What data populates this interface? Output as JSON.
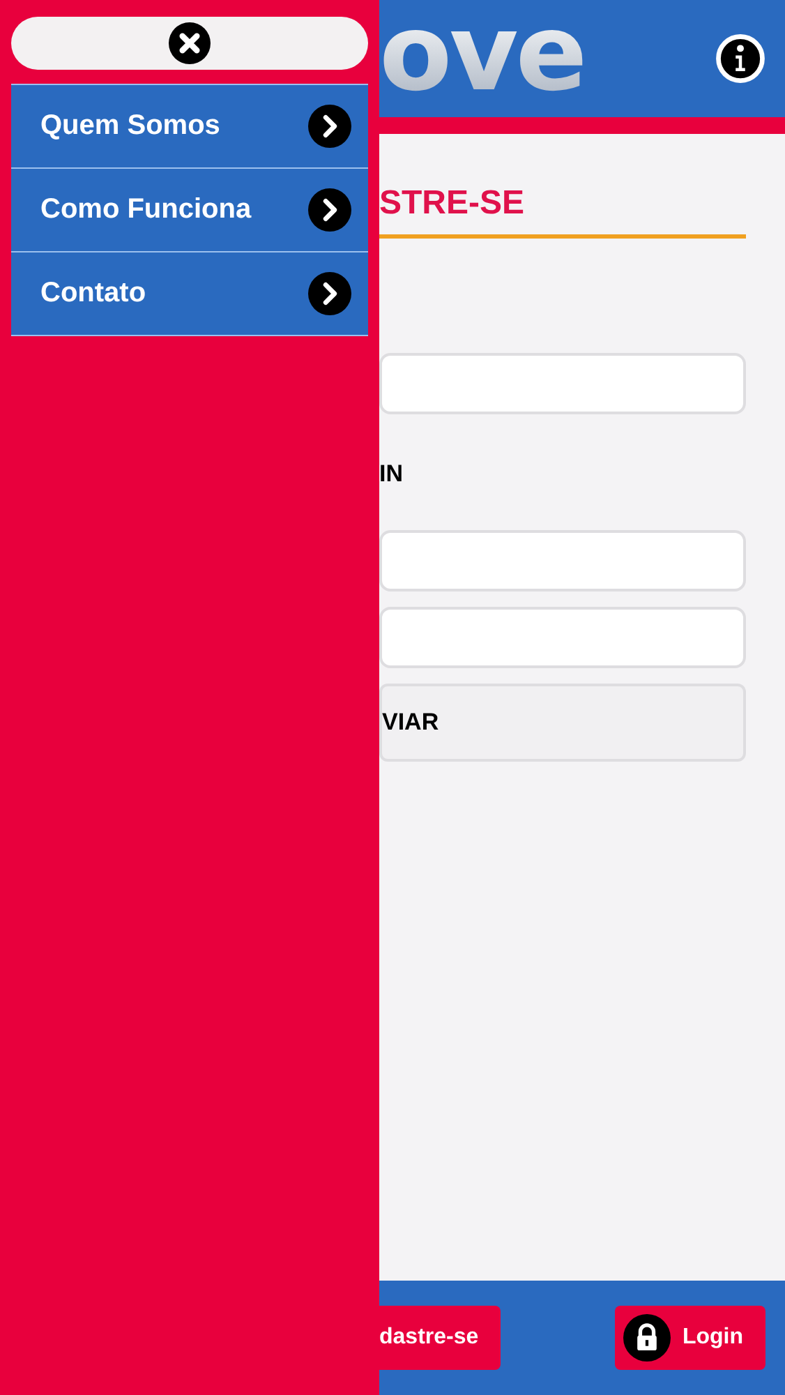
{
  "drawer": {
    "menu": [
      {
        "label": "Quem Somos"
      },
      {
        "label": "Como Funciona"
      },
      {
        "label": "Contato"
      }
    ]
  },
  "header": {
    "logo_text": "ove"
  },
  "form": {
    "title": "STRE-SE",
    "fields_top": [
      {
        "kind": "text"
      }
    ],
    "login_label": "IN",
    "fields_login": [
      {
        "kind": "text"
      },
      {
        "kind": "text"
      }
    ],
    "submit": "VIAR"
  },
  "footer": {
    "buttons": [
      {
        "label": "dastre-se",
        "kind": "plain"
      },
      {
        "label": "Login",
        "kind": "lock"
      }
    ]
  }
}
